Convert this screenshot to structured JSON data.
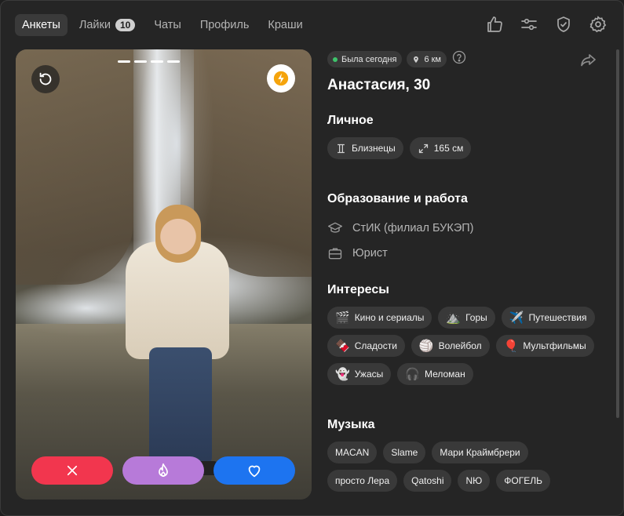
{
  "nav": {
    "tabs": [
      {
        "label": "Анкеты",
        "active": true
      },
      {
        "label": "Лайки",
        "count": "10"
      },
      {
        "label": "Чаты"
      },
      {
        "label": "Профиль"
      },
      {
        "label": "Краши"
      }
    ],
    "icons": [
      "thumbs-up-icon",
      "sliders-icon",
      "shield-check-icon",
      "gear-icon"
    ]
  },
  "profile": {
    "status": "Была сегодня",
    "distance": "6 км",
    "name": "Анастасия, 30",
    "photo_count": 4
  },
  "personal": {
    "title": "Личное",
    "zodiac": "Близнецы",
    "height": "165 см"
  },
  "education": {
    "title": "Образование и работа",
    "school": "СтИК (филиал БУКЭП)",
    "job": "Юрист"
  },
  "interests": {
    "title": "Интересы",
    "items": [
      {
        "emoji": "🎬",
        "label": "Кино и сериалы"
      },
      {
        "emoji": "⛰️",
        "label": "Горы"
      },
      {
        "emoji": "✈️",
        "label": "Путешествия"
      },
      {
        "emoji": "🍫",
        "label": "Сладости"
      },
      {
        "emoji": "🏐",
        "label": "Волейбол"
      },
      {
        "emoji": "🎈",
        "label": "Мультфильмы"
      },
      {
        "emoji": "👻",
        "label": "Ужасы"
      },
      {
        "emoji": "🎧",
        "label": "Меломан"
      }
    ]
  },
  "music": {
    "title": "Музыка",
    "items": [
      "MACAN",
      "Slame",
      "Мари Краймбрери",
      "просто Лера",
      "Qatoshi",
      "NЮ",
      "ФОГЕЛЬ"
    ]
  },
  "colors": {
    "dislike": "#f2364e",
    "superlike": "#b77ad9",
    "like": "#1d74f0",
    "online": "#3ec46b"
  }
}
